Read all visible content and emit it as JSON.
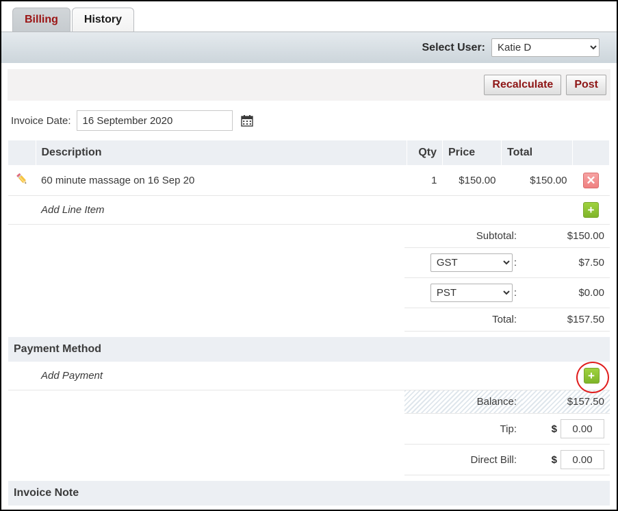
{
  "tabs": [
    {
      "label": "Billing",
      "active": true
    },
    {
      "label": "History",
      "active": false
    }
  ],
  "user_bar": {
    "label": "Select User:",
    "selected": "Katie D",
    "options": [
      "Katie D"
    ]
  },
  "toolbar": {
    "recalculate_label": "Recalculate",
    "post_label": "Post"
  },
  "invoice_date": {
    "label": "Invoice Date:",
    "value": "16 September 2020",
    "calendar_icon": "calendar-icon"
  },
  "line_items_table": {
    "headers": {
      "icon": "",
      "description": "Description",
      "qty": "Qty",
      "price": "Price",
      "total": "Total",
      "action": ""
    },
    "rows": [
      {
        "edit_icon": "pencil-icon",
        "description": "60 minute massage on 16 Sep 20",
        "qty": "1",
        "price": "$150.00",
        "total": "$150.00",
        "delete_icon": "close-icon"
      }
    ],
    "add_row": {
      "placeholder": "Add Line Item",
      "add_icon": "plus-icon"
    }
  },
  "totals": {
    "subtotal_label": "Subtotal:",
    "subtotal_value": "$150.00",
    "tax1_selected": "GST",
    "tax1_options": [
      "GST"
    ],
    "tax1_value": "$7.50",
    "tax2_selected": "PST",
    "tax2_options": [
      "PST"
    ],
    "tax2_value": "$0.00",
    "total_label": "Total:",
    "total_value": "$157.50",
    "colon": ":"
  },
  "payment_method": {
    "section_label": "Payment Method",
    "add_placeholder": "Add Payment",
    "add_icon": "plus-icon",
    "add_annotated": true
  },
  "balance": {
    "balance_label": "Balance:",
    "balance_value": "$157.50",
    "tip_label": "Tip:",
    "tip_currency": "$",
    "tip_value": "0.00",
    "direct_bill_label": "Direct Bill:",
    "direct_bill_currency": "$",
    "direct_bill_value": "0.00"
  },
  "invoice_note": {
    "section_label": "Invoice Note"
  },
  "colors": {
    "active_tab_text": "#9b1414",
    "button_text": "#8e1616",
    "balance_red": "#e01b1b",
    "annotation_red": "#e01d1d",
    "add_green": "#8fc63d",
    "delete_red": "#ef8181",
    "header_bg": "#eceff3"
  }
}
